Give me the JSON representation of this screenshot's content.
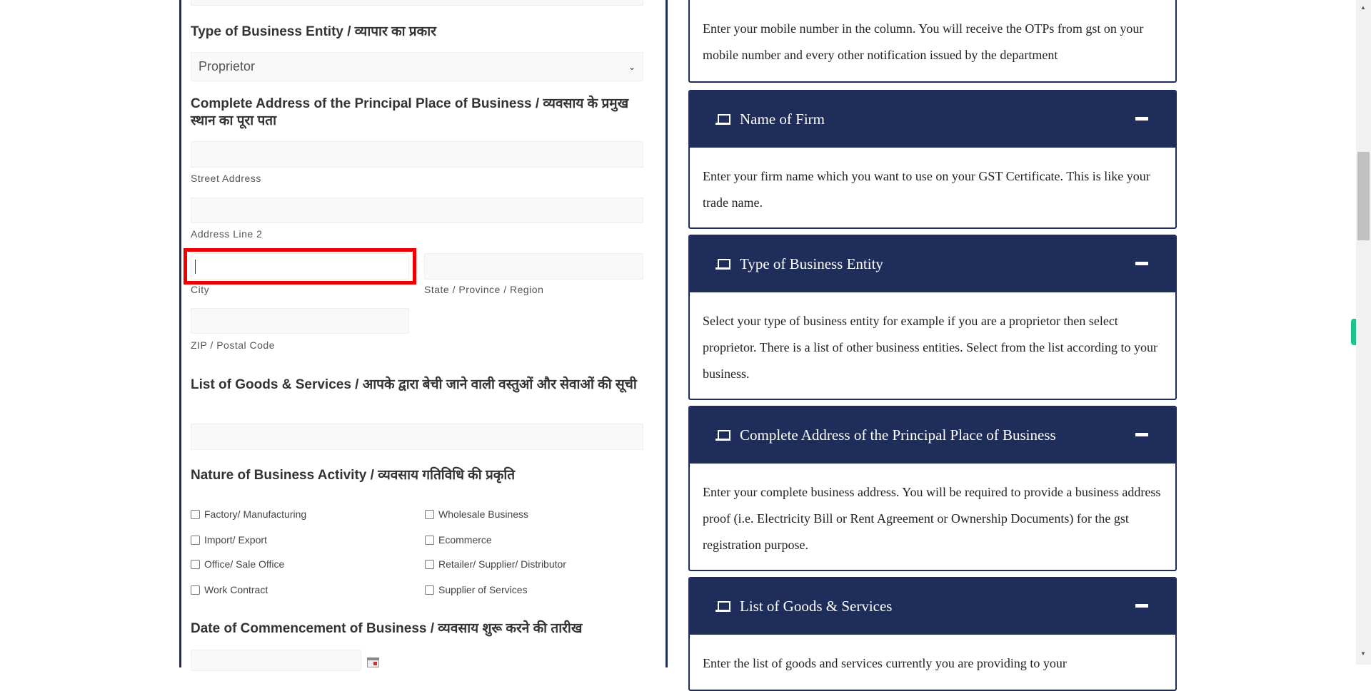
{
  "form": {
    "business_entity": {
      "heading": "Type of Business Entity / व्यापार का प्रकार",
      "selected": "Proprietor"
    },
    "address": {
      "heading": "Complete Address of the Principal Place of Business / व्यवसाय के प्रमुख स्थान का पूरा पता",
      "street_label": "Street Address",
      "line2_label": "Address Line 2",
      "city_label": "City",
      "state_label": "State / Province / Region",
      "zip_label": "ZIP / Postal Code"
    },
    "goods": {
      "heading": "List of Goods & Services / आपके द्वारा बेची जाने वाली वस्तुओं और सेवाओं की सूची"
    },
    "nature": {
      "heading": "Nature of Business Activity / व्यवसाय गतिविधि की प्रकृति",
      "options": [
        "Factory/ Manufacturing",
        "Wholesale Business",
        "Import/ Export",
        "Ecommerce",
        "Office/ Sale Office",
        "Retailer/ Supplier/ Distributor",
        "Work Contract",
        "Supplier of Services"
      ]
    },
    "date": {
      "heading": "Date of Commencement of Business / व्यवसाय शुरू करने की तारीख"
    }
  },
  "help": {
    "top_text": "Enter your mobile number in the column. You will receive the OTPs from gst on your mobile number and every other notification issued by the department",
    "cards": [
      {
        "title": "Name of Firm",
        "text": "Enter your firm name which you want to use on your GST Certificate. This is like your trade name."
      },
      {
        "title": "Type of Business Entity",
        "text": "Select your type of business entity for example if you are a proprietor then select proprietor. There is a list of other business entities. Select from the list according to your business."
      },
      {
        "title": "Complete Address of the Principal Place of Business",
        "text": "Enter your complete business address. You will be required to provide a business address proof (i.e. Electricity Bill or Rent Agreement or Ownership Documents) for the gst registration purpose."
      },
      {
        "title": "List of Goods & Services",
        "text": "Enter the list of goods and services currently you are providing to your"
      }
    ]
  },
  "colors": {
    "header": "#1f2d5a",
    "highlight": "#ee0000",
    "accent": "#1ec28b"
  }
}
